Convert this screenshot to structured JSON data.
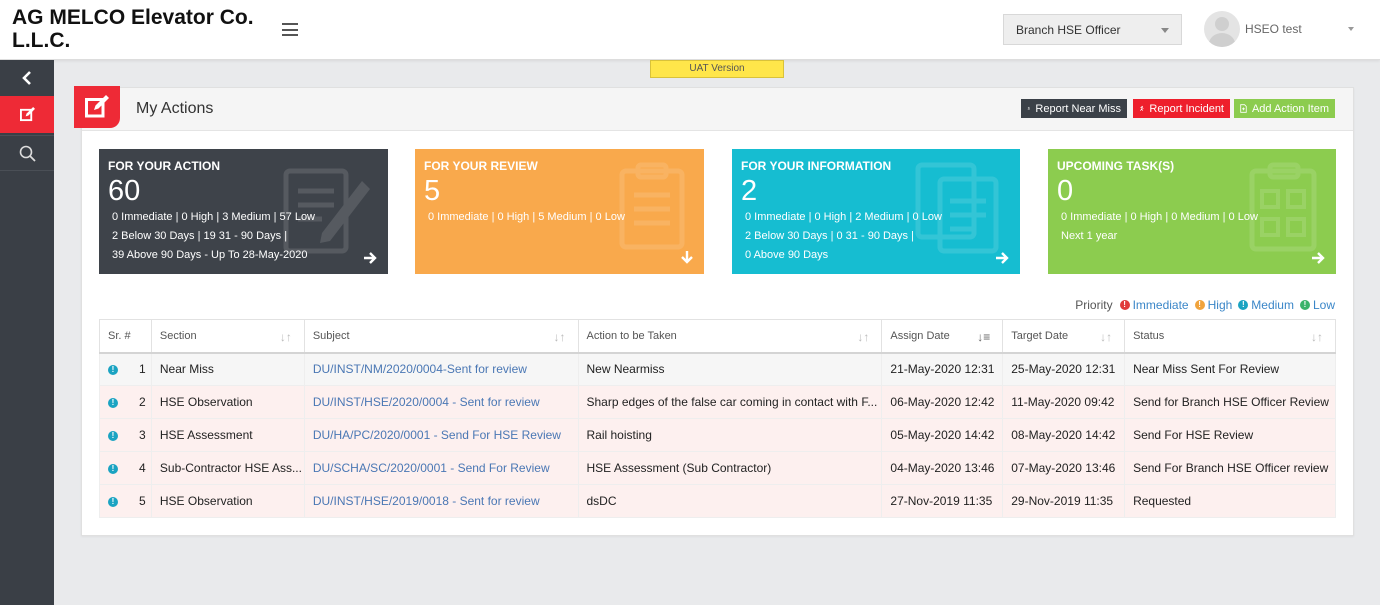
{
  "header": {
    "company": "AG MELCO Elevator Co. L.L.C.",
    "role_select": "Branch HSE Officer",
    "user_name": "HSEO test",
    "uat_label": "UAT Version"
  },
  "page": {
    "title": "My Actions",
    "buttons": {
      "near_miss": "Report Near Miss",
      "incident": "Report Incident",
      "add_action": "Add Action Item"
    }
  },
  "cards": {
    "action": {
      "title": "FOR YOUR ACTION",
      "count": "60",
      "line1": "0 Immediate | 0 High | 3 Medium | 57 Low",
      "line2": "2 Below 30 Days | 19 31 - 90 Days |",
      "line3": "39 Above 90 Days  - Up To 28-May-2020"
    },
    "review": {
      "title": "FOR YOUR REVIEW",
      "count": "5",
      "line1": "0 Immediate | 0 High | 5 Medium | 0 Low"
    },
    "information": {
      "title": "FOR YOUR INFORMATION",
      "count": "2",
      "line1": "0 Immediate | 0 High | 2 Medium | 0 Low",
      "line2": "2 Below 30 Days | 0 31 - 90 Days |",
      "line3": "0 Above 90 Days"
    },
    "upcoming": {
      "title": "UPCOMING TASK(S)",
      "count": "0",
      "line1": "0 Immediate | 0 High | 0 Medium | 0 Low",
      "line2": "Next 1 year"
    },
    "colors": {
      "action": "#3e434a",
      "review": "#f9a94c",
      "information": "#16bdd1",
      "upcoming": "#8ccc4f"
    }
  },
  "priority_legend": {
    "label": "Priority",
    "items": [
      "Immediate",
      "High",
      "Medium",
      "Low"
    ],
    "colors": [
      "#e03a3a",
      "#f0a33c",
      "#1aa3c2",
      "#3bb36a"
    ]
  },
  "table": {
    "headers": [
      "Sr. #",
      "Section",
      "Subject",
      "Action to be Taken",
      "Assign Date",
      "Target Date",
      "Status"
    ],
    "rows": [
      {
        "sr": "1",
        "section": "Near Miss",
        "subject": "DU/INST/NM/2020/0004-Sent for review",
        "action": "New Nearmiss",
        "assign": "21-May-2020 12:31",
        "target": "25-May-2020 12:31",
        "status": "Near Miss Sent For Review"
      },
      {
        "sr": "2",
        "section": "HSE Observation",
        "subject": "DU/INST/HSE/2020/0004 - Sent for review",
        "action": "Sharp edges of the false car coming in contact with F...",
        "assign": "06-May-2020 12:42",
        "target": "11-May-2020 09:42",
        "status": "Send for Branch HSE Officer Review"
      },
      {
        "sr": "3",
        "section": "HSE Assessment",
        "subject": "DU/HA/PC/2020/0001 - Send For HSE Review",
        "action": "Rail hoisting",
        "assign": "05-May-2020 14:42",
        "target": "08-May-2020 14:42",
        "status": "Send For HSE Review"
      },
      {
        "sr": "4",
        "section": "Sub-Contractor HSE Ass...",
        "subject": "DU/SCHA/SC/2020/0001 - Send For Review",
        "action": "HSE Assessment (Sub Contractor)",
        "assign": "04-May-2020 13:46",
        "target": "07-May-2020 13:46",
        "status": "Send For Branch HSE Officer review"
      },
      {
        "sr": "5",
        "section": "HSE Observation",
        "subject": "DU/INST/HSE/2019/0018 - Sent for review",
        "action": "dsDC",
        "assign": "27-Nov-2019 11:35",
        "target": "29-Nov-2019 11:35",
        "status": "Requested"
      }
    ]
  }
}
